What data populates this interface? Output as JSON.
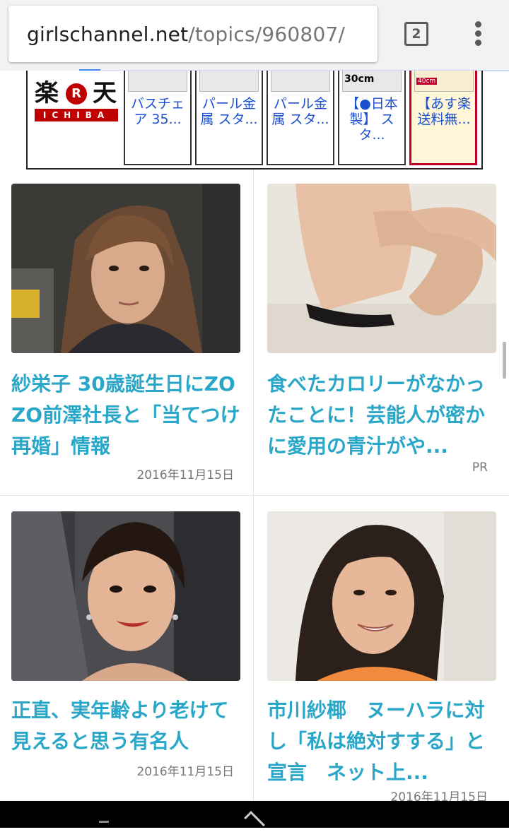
{
  "browser": {
    "url_host": "girlschannel.net",
    "url_path": "/topics/960807/",
    "tab_count": "2",
    "load_progress": 0.04
  },
  "ad": {
    "logo_text": "楽天",
    "logo_r": "R",
    "logo_sub": "ICHIBA",
    "items": [
      {
        "label": "バスチェア 35...",
        "thumb": ""
      },
      {
        "label": "パール金属 スタ...",
        "thumb": ""
      },
      {
        "label": "パール金属 スタ...",
        "thumb": ""
      },
      {
        "label": "【●日本製】 スタ...",
        "thumb": "30cm"
      },
      {
        "label": "【あす楽 送料無...",
        "thumb": "40cm"
      }
    ]
  },
  "articles": [
    {
      "title": "紗栄子 30歳誕生日にZOZO前澤社長と「当てつけ再婚」情報",
      "meta": "2016年11月15日"
    },
    {
      "title": "食べたカロリーがなかったことに！芸能人が密かに愛用の青汁がや...",
      "meta": "PR"
    },
    {
      "title": "正直、実年齢より老けて見えると思う有名人",
      "meta": "2016年11月15日"
    },
    {
      "title": "市川紗椰　ヌーハラに対し「私は絶対すする」と宣言　ネット上...",
      "meta": "2016年11月15日"
    }
  ],
  "colors": {
    "title": "#2aa7c8",
    "rakuten_red": "#bf0000",
    "ad_link": "#1a4fd0"
  }
}
